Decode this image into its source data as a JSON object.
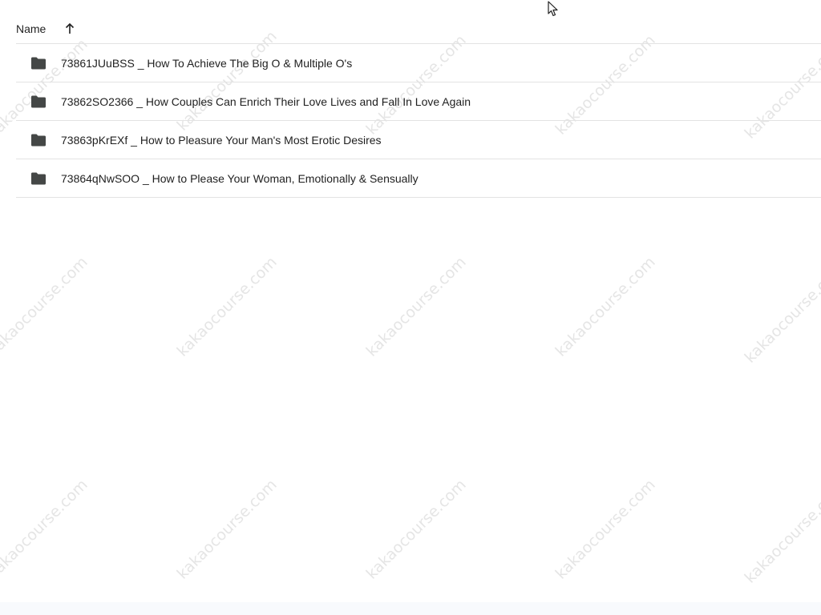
{
  "header": {
    "name_label": "Name",
    "sort_icon": "arrow-up-icon"
  },
  "rows": [
    {
      "icon": "folder-icon",
      "name": "73861JUuBSS _ How To Achieve The Big O & Multiple O's"
    },
    {
      "icon": "folder-icon",
      "name": "73862SO2366 _ How Couples Can Enrich Their Love Lives and Fall In Love Again"
    },
    {
      "icon": "folder-icon",
      "name": "73863pKrEXf _ How to Pleasure Your Man's Most Erotic Desires"
    },
    {
      "icon": "folder-icon",
      "name": "73864qNwSOO _ How to Please Your Woman, Emotionally & Sensually"
    }
  ],
  "watermark": {
    "text": "kakaocourse.com"
  },
  "colors": {
    "text": "#1f1f1f",
    "divider": "#e3e3e3",
    "icon": "#444746"
  }
}
